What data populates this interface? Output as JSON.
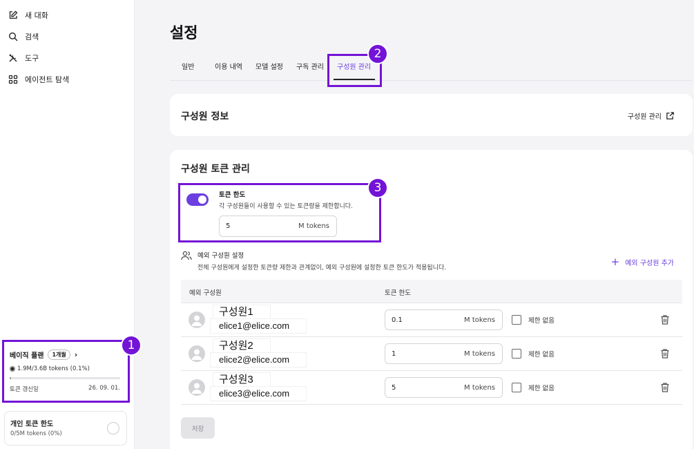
{
  "sidebar": {
    "items": [
      {
        "label": "새 대화",
        "icon": "edit-icon"
      },
      {
        "label": "검색",
        "icon": "search-icon"
      },
      {
        "label": "도구",
        "icon": "tools-icon"
      },
      {
        "label": "에이전트 탐색",
        "icon": "grid-icon"
      }
    ],
    "plan": {
      "name": "베이직 플랜",
      "badge": "1개월",
      "usage": "1.9M/3.6B tokens (0.1%)",
      "usage_fraction": 0.001,
      "renew_label": "토큰 갱신일",
      "renew_date": "26. 09. 01."
    },
    "personal": {
      "title": "개인 토큰 한도",
      "usage": "0/5M tokens (0%)"
    }
  },
  "page": {
    "title": "설정",
    "tabs": [
      "일반",
      "이용 내역",
      "모델 설정",
      "구독 관리",
      "구성원 관리"
    ],
    "active_tab": "구성원 관리"
  },
  "member_info": {
    "title": "구성원 정보",
    "link_label": "구성원 관리"
  },
  "token_mgmt": {
    "title": "구성원 토큰 관리",
    "limit_title": "토큰 한도",
    "limit_desc": "각 구성원들이 사용할 수 있는 토큰량을 제한합니다.",
    "limit_enabled": true,
    "limit_value": "5",
    "unit": "M tokens",
    "exception_title": "예외 구성원 설정",
    "exception_desc": "전체 구성원에게 설정한 토큰량 제한과 관계없이, 예외 구성원에 설정한 토큰 한도가 적용됩니다.",
    "add_label": "예외 구성원 추가",
    "col_member": "예외 구성원",
    "col_limit": "토큰 한도",
    "no_limit_label": "제한 없음",
    "members": [
      {
        "name": "구성원1",
        "email": "elice1@elice.com",
        "limit": "0.1"
      },
      {
        "name": "구성원2",
        "email": "elice2@elice.com",
        "limit": "1"
      },
      {
        "name": "구성원3",
        "email": "elice3@elice.com",
        "limit": "5"
      }
    ],
    "save_label": "저장"
  },
  "callouts": [
    "1",
    "2",
    "3"
  ],
  "colors": {
    "accent": "#6b3fe0",
    "highlight": "#7313d6"
  }
}
